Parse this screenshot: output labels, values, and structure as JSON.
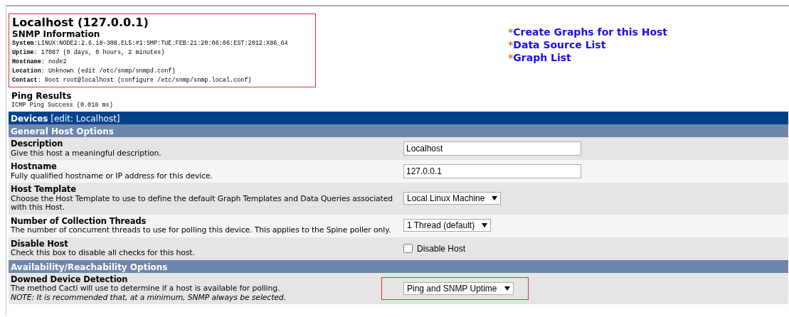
{
  "host": {
    "title": "Localhost (127.0.0.1)",
    "highlighted": true,
    "snmp_heading": "SNMP Information",
    "info": [
      {
        "label": "System",
        "value": ":LINUX:NODE2:2.6.18-308.EL5:#1:SMP:TUE:FEB:21:20:06:06:EST:2012:X86_64"
      },
      {
        "label": "Uptime",
        "value": ": 17087 (0 days, 0 hours, 2 minutes)"
      },
      {
        "label": "Hostname",
        "value": ": node2"
      },
      {
        "label": "Location",
        "value": ": Unknown (edit /etc/snmp/snmpd.conf)"
      },
      {
        "label": "Contact",
        "value": ": Root root@localhost (configure /etc/snmp/snmp.local.conf)"
      }
    ]
  },
  "links": [
    {
      "bullet": "*",
      "label": "Create Graphs for this Host"
    },
    {
      "bullet": "*",
      "label": "Data Source List"
    },
    {
      "bullet": "*",
      "label": "Graph List"
    }
  ],
  "ping": {
    "heading": "Ping Results",
    "result": "ICMP Ping Success (0.018 ms)"
  },
  "form": {
    "title": "**Devices** [edit: Localhost]",
    "sections": [
      {
        "heading": "General Host Options",
        "rows": [
          {
            "kind": "text",
            "label": "Description",
            "description": "Give this host a meaningful description.",
            "value": "Localhost",
            "highlighted": false
          },
          {
            "kind": "text",
            "label": "Hostname",
            "description": "Fully qualified hostname or IP address for this device.",
            "value": "127.0.0.1",
            "highlighted": false
          },
          {
            "kind": "select",
            "label": "Host Template",
            "description": "Choose the Host Template to use to define the default Graph Templates and Data Queries associated with this Host.",
            "value": "Local Linux Machine",
            "highlighted": false
          },
          {
            "kind": "select",
            "label": "Number of Collection Threads",
            "description": "The number of concurrent threads to use for polling this device. This applies to the Spine poller only.",
            "value": "1 Thread (default)",
            "highlighted": false
          },
          {
            "kind": "checkbox",
            "label": "Disable Host",
            "description": "Check this box to disable all checks for this host.",
            "value": "Disable Host",
            "checked": false,
            "highlighted": false
          }
        ]
      },
      {
        "heading": "Availability/Reachability Options",
        "rows": [
          {
            "kind": "select",
            "label": "Downed Device Detection",
            "description": "The method Cacti will use to determine if a host is available for polling.",
            "note": "NOTE: It is recommended that, at a minimum, SNMP always be selected.",
            "value": "Ping and SNMP Uptime",
            "highlighted": true
          }
        ]
      }
    ]
  }
}
